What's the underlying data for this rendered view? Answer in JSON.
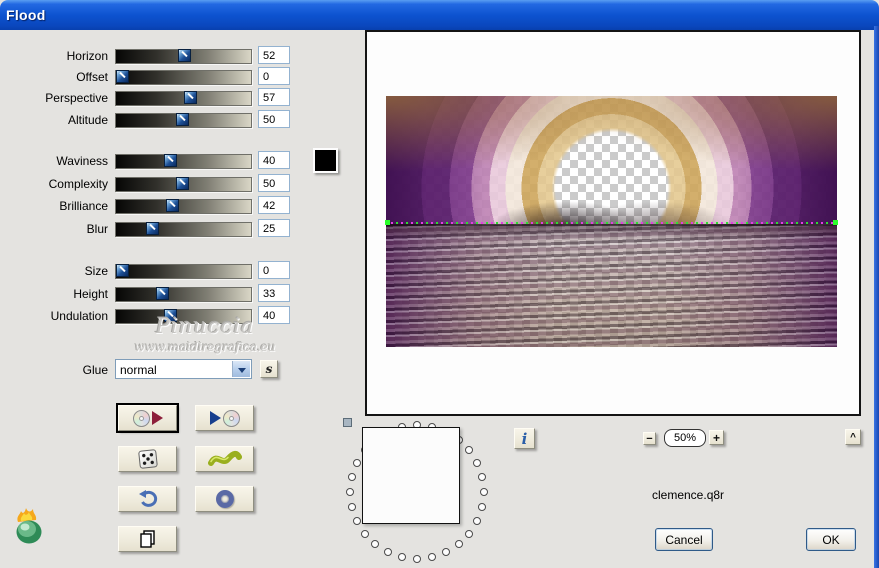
{
  "titlebar": {
    "title": "Flood"
  },
  "sliders": {
    "horizon": {
      "label": "Horizon",
      "value": "52"
    },
    "offset": {
      "label": "Offset",
      "value": "0"
    },
    "perspective": {
      "label": "Perspective",
      "value": "57"
    },
    "altitude": {
      "label": "Altitude",
      "value": "50"
    },
    "waviness": {
      "label": "Waviness",
      "value": "40"
    },
    "complexity": {
      "label": "Complexity",
      "value": "50"
    },
    "brilliance": {
      "label": "Brilliance",
      "value": "42"
    },
    "blur": {
      "label": "Blur",
      "value": "25"
    },
    "size": {
      "label": "Size",
      "value": "0"
    },
    "height": {
      "label": "Height",
      "value": "33"
    },
    "undulation": {
      "label": "Undulation",
      "value": "40"
    }
  },
  "color_swatch": {
    "color": "#000000"
  },
  "watermark": {
    "name": "Pinuccia",
    "url": "www.maidiregrafica.eu"
  },
  "glue": {
    "label": "Glue",
    "value": "normal"
  },
  "icons": {
    "glue_shuffle": "s",
    "info": "i",
    "zoom_out": "−",
    "zoom_in": "+",
    "caret": "^"
  },
  "preview": {
    "zoom_level": "50%",
    "preset_name": "clemence.q8r",
    "horizon_marker_colors": {
      "green": "#2ede2e",
      "magenta": "#e040e0"
    }
  },
  "actions": {
    "cancel": "Cancel",
    "ok": "OK"
  }
}
